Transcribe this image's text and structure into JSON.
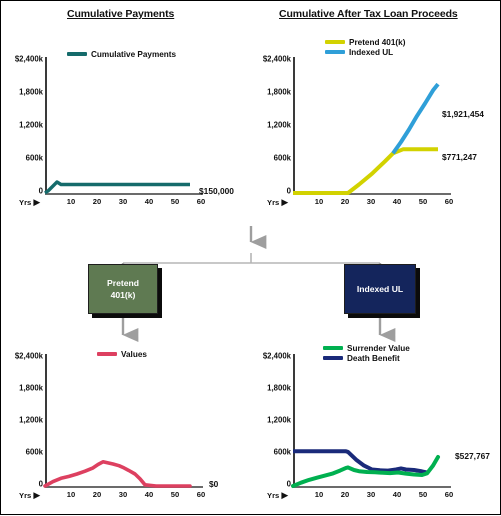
{
  "charts": [
    {
      "id": "cumulative-payments",
      "title": "Cumulative Payments",
      "legend": [
        {
          "label": "Cumulative Payments",
          "color": "#156b6b"
        }
      ],
      "y_ticks": [
        "$2,400k",
        "1,800k",
        "1,200k",
        "600k",
        "0"
      ],
      "x_ticks": [
        "10",
        "20",
        "30",
        "40",
        "50",
        "60"
      ],
      "x_axis_label": "Yrs",
      "end_labels": [
        {
          "text": "$150,000",
          "color": "#111111"
        }
      ]
    },
    {
      "id": "cumulative-after-tax-loan-proceeds",
      "title": "Cumulative After Tax Loan Proceeds",
      "legend": [
        {
          "label": "Pretend 401(k)",
          "color": "#d2d200"
        },
        {
          "label": "Indexed UL",
          "color": "#2f9fd8"
        }
      ],
      "y_ticks": [
        "$2,400k",
        "1,800k",
        "1,200k",
        "600k",
        "0"
      ],
      "x_ticks": [
        "10",
        "20",
        "30",
        "40",
        "50",
        "60"
      ],
      "x_axis_label": "Yrs",
      "end_labels": [
        {
          "text": "$1,921,454",
          "color": "#111111"
        },
        {
          "text": "$771,247",
          "color": "#111111"
        }
      ]
    },
    {
      "id": "pretend-401k-values",
      "title": "",
      "legend": [
        {
          "label": "Values",
          "color": "#dd4060"
        }
      ],
      "y_ticks": [
        "$2,400k",
        "1,800k",
        "1,200k",
        "600k",
        "0"
      ],
      "x_ticks": [
        "10",
        "20",
        "30",
        "40",
        "50",
        "60"
      ],
      "x_axis_label": "Yrs",
      "end_labels": [
        {
          "text": "$0",
          "color": "#111111"
        }
      ]
    },
    {
      "id": "indexed-ul-values",
      "title": "",
      "legend": [
        {
          "label": "Surrender Value",
          "color": "#00b050"
        },
        {
          "label": "Death Benefit",
          "color": "#1a2a7a"
        }
      ],
      "y_ticks": [
        "$2,400k",
        "1,800k",
        "1,200k",
        "600k",
        "0"
      ],
      "x_ticks": [
        "10",
        "20",
        "30",
        "40",
        "50",
        "60"
      ],
      "x_axis_label": "Yrs",
      "end_labels": [
        {
          "text": "$527,767",
          "color": "#111111"
        }
      ]
    }
  ],
  "flow": {
    "left_box": {
      "line1": "Pretend",
      "line2": "401(k)",
      "color": "#5f7a52"
    },
    "right_box": {
      "line1": "Indexed UL",
      "line2": "",
      "color": "#14255c"
    }
  },
  "chart_data": [
    {
      "type": "line",
      "title": "Cumulative Payments",
      "xlabel": "Yrs",
      "ylabel": "",
      "xlim": [
        0,
        60
      ],
      "ylim": [
        0,
        2400
      ],
      "yticks": [
        0,
        600,
        1200,
        1800,
        2400
      ],
      "ytick_labels": [
        "0",
        "600k",
        "1,200k",
        "1,800k",
        "$2,400k"
      ],
      "xticks": [
        10,
        20,
        30,
        40,
        50,
        60
      ],
      "grid": false,
      "legend_position": "top-center",
      "units": "thousands of dollars",
      "annotations": [
        {
          "text": "$150,000",
          "x": 56,
          "y": 150
        }
      ],
      "series": [
        {
          "name": "Cumulative Payments",
          "color": "#156b6b",
          "x": [
            0,
            1,
            2,
            3,
            4,
            5,
            6,
            7,
            10,
            15,
            20,
            25,
            30,
            35,
            40,
            45,
            50,
            55
          ],
          "values": [
            0,
            30,
            60,
            90,
            120,
            150,
            150,
            150,
            150,
            150,
            150,
            150,
            150,
            150,
            150,
            150,
            150,
            150
          ]
        }
      ]
    },
    {
      "type": "line",
      "title": "Cumulative After Tax Loan Proceeds",
      "xlabel": "Yrs",
      "ylabel": "",
      "xlim": [
        0,
        60
      ],
      "ylim": [
        0,
        2400
      ],
      "yticks": [
        0,
        600,
        1200,
        1800,
        2400
      ],
      "ytick_labels": [
        "0",
        "600k",
        "1,200k",
        "1,800k",
        "$2,400k"
      ],
      "xticks": [
        10,
        20,
        30,
        40,
        50,
        60
      ],
      "grid": false,
      "legend_position": "top-center",
      "units": "thousands of dollars",
      "annotations": [
        {
          "text": "$1,921,454",
          "x": 56,
          "y": 1921
        },
        {
          "text": "$771,247",
          "x": 56,
          "y": 771
        }
      ],
      "series": [
        {
          "name": "Pretend 401(k)",
          "color": "#d2d200",
          "x": [
            0,
            5,
            10,
            15,
            21,
            25,
            30,
            35,
            38,
            42,
            46,
            50,
            55
          ],
          "values": [
            0,
            0,
            0,
            0,
            0,
            150,
            340,
            560,
            700,
            771,
            771,
            771,
            771
          ]
        },
        {
          "name": "Indexed UL",
          "color": "#2f9fd8",
          "x": [
            38,
            41,
            44,
            47,
            50,
            53,
            55
          ],
          "values": [
            700,
            900,
            1120,
            1360,
            1580,
            1810,
            1921
          ]
        }
      ]
    },
    {
      "type": "line",
      "title": "Pretend 401(k) Values",
      "xlabel": "Yrs",
      "ylabel": "",
      "xlim": [
        0,
        60
      ],
      "ylim": [
        0,
        2400
      ],
      "yticks": [
        0,
        600,
        1200,
        1800,
        2400
      ],
      "ytick_labels": [
        "0",
        "600k",
        "1,200k",
        "1,800k",
        "$2,400k"
      ],
      "xticks": [
        10,
        20,
        30,
        40,
        50,
        60
      ],
      "grid": false,
      "legend_position": "top-center",
      "units": "thousands of dollars",
      "annotations": [
        {
          "text": "$0",
          "x": 57,
          "y": 0
        }
      ],
      "series": [
        {
          "name": "Values",
          "color": "#dd4060",
          "x": [
            0,
            3,
            6,
            9,
            12,
            15,
            18,
            20,
            22,
            24,
            26,
            28,
            30,
            32,
            34,
            36,
            38,
            42,
            46,
            50,
            55
          ],
          "values": [
            0,
            80,
            140,
            175,
            220,
            270,
            330,
            390,
            440,
            420,
            400,
            370,
            330,
            280,
            210,
            130,
            20,
            0,
            0,
            0,
            0
          ]
        }
      ]
    },
    {
      "type": "line",
      "title": "Indexed UL Values",
      "xlabel": "Yrs",
      "ylabel": "",
      "xlim": [
        0,
        60
      ],
      "ylim": [
        0,
        2400
      ],
      "yticks": [
        0,
        600,
        1200,
        1800,
        2400
      ],
      "ytick_labels": [
        "0",
        "600k",
        "1,200k",
        "1,800k",
        "$2,400k"
      ],
      "xticks": [
        10,
        20,
        30,
        40,
        50,
        60
      ],
      "grid": false,
      "legend_position": "top-center",
      "units": "thousands of dollars",
      "annotations": [
        {
          "text": "$527,767",
          "x": 57,
          "y": 528
        }
      ],
      "series": [
        {
          "name": "Surrender Value",
          "color": "#00b050",
          "x": [
            0,
            3,
            6,
            9,
            12,
            15,
            18,
            20,
            21,
            23,
            25,
            28,
            31,
            34,
            37,
            40,
            43,
            46,
            49,
            51,
            53,
            55
          ],
          "values": [
            0,
            60,
            110,
            150,
            190,
            230,
            280,
            330,
            340,
            290,
            270,
            255,
            250,
            240,
            235,
            245,
            225,
            210,
            200,
            230,
            370,
            528
          ]
        },
        {
          "name": "Death Benefit",
          "color": "#1a2a7a",
          "x": [
            0,
            5,
            10,
            15,
            20,
            21,
            24,
            27,
            30,
            33,
            36,
            39,
            41,
            43,
            46,
            49,
            51
          ],
          "values": [
            630,
            630,
            630,
            630,
            630,
            620,
            480,
            370,
            300,
            285,
            280,
            300,
            320,
            300,
            290,
            265,
            245
          ]
        }
      ]
    }
  ]
}
